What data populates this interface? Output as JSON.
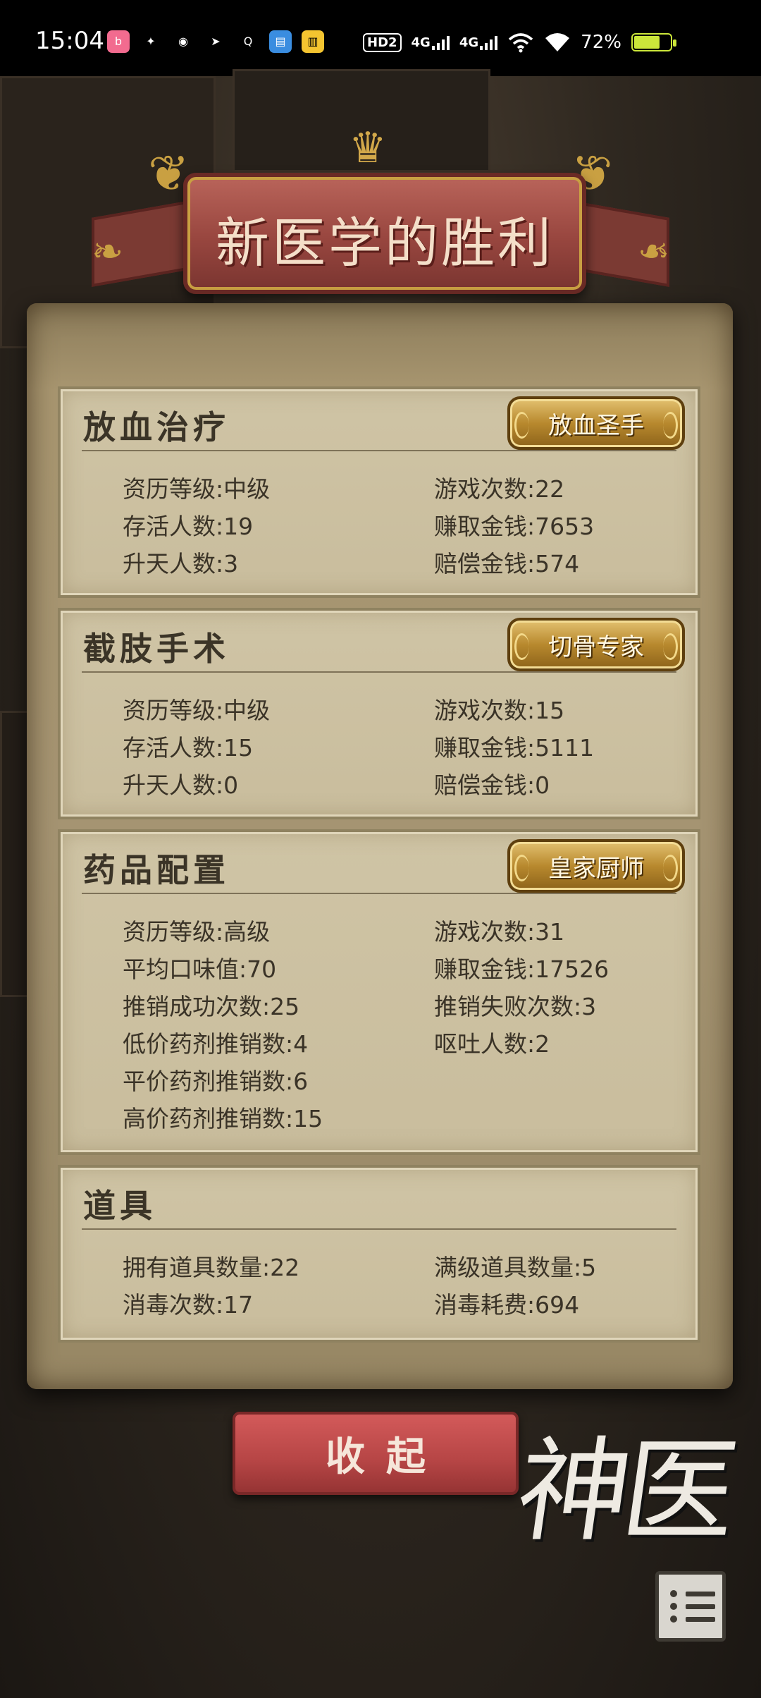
{
  "status_bar": {
    "time": "15:04",
    "apps": [
      {
        "icon": "bilibili-icon",
        "color": "#f26b8f",
        "glyph": "b"
      },
      {
        "icon": "qq-icon",
        "color": "#000000",
        "glyph": "✦"
      },
      {
        "icon": "weibo-icon",
        "color": "#000000",
        "glyph": "◉"
      },
      {
        "icon": "telegram-icon",
        "color": "#000000",
        "glyph": "➤"
      },
      {
        "icon": "search-app-icon",
        "color": "#000000",
        "glyph": "Q"
      },
      {
        "icon": "news-app-icon",
        "color": "#3a8de0",
        "glyph": "▤"
      },
      {
        "icon": "reader-app-icon",
        "color": "#f4c430",
        "glyph": "▥"
      }
    ],
    "hd": "HD2",
    "network_1": "4G",
    "network_2": "4G",
    "battery": "72%",
    "battery_level": 0.72
  },
  "banner": {
    "title": "新医学的胜利"
  },
  "sections": [
    {
      "title": "放血治疗",
      "badge": "放血圣手",
      "left": [
        {
          "label": "资历等级",
          "value": "中级"
        },
        {
          "label": "存活人数",
          "value": "19"
        },
        {
          "label": "升天人数",
          "value": "3"
        }
      ],
      "right": [
        {
          "label": "游戏次数",
          "value": "22"
        },
        {
          "label": "赚取金钱",
          "value": "7653"
        },
        {
          "label": "赔偿金钱",
          "value": "574"
        }
      ]
    },
    {
      "title": "截肢手术",
      "badge": "切骨专家",
      "left": [
        {
          "label": "资历等级",
          "value": "中级"
        },
        {
          "label": "存活人数",
          "value": "15"
        },
        {
          "label": "升天人数",
          "value": "0"
        }
      ],
      "right": [
        {
          "label": "游戏次数",
          "value": "15"
        },
        {
          "label": "赚取金钱",
          "value": "5111"
        },
        {
          "label": "赔偿金钱",
          "value": "0"
        }
      ]
    },
    {
      "title": "药品配置",
      "badge": "皇家厨师",
      "left": [
        {
          "label": "资历等级",
          "value": "高级"
        },
        {
          "label": "平均口味值",
          "value": "70"
        },
        {
          "label": "推销成功次数",
          "value": "25"
        },
        {
          "label": "低价药剂推销数",
          "value": "4"
        },
        {
          "label": "平价药剂推销数",
          "value": "6"
        },
        {
          "label": "高价药剂推销数",
          "value": "15"
        }
      ],
      "right": [
        {
          "label": "游戏次数",
          "value": "31"
        },
        {
          "label": "赚取金钱",
          "value": "17526"
        },
        {
          "label": "推销失败次数",
          "value": "3"
        },
        {
          "label": "呕吐人数",
          "value": "2"
        }
      ]
    },
    {
      "title": "道具",
      "left": [
        {
          "label": "拥有道具数量",
          "value": "22"
        },
        {
          "label": "消毒次数",
          "value": "17"
        }
      ],
      "right": [
        {
          "label": "满级道具数量",
          "value": "5"
        },
        {
          "label": "消毒耗费",
          "value": "694"
        }
      ]
    }
  ],
  "collapse_button": "收起",
  "logo_text": "神医",
  "colors": {
    "ribbon": "#98463f",
    "badge_gold": "#b8892e",
    "collapse_red": "#b64545",
    "parchment": "#cfc4a5"
  }
}
